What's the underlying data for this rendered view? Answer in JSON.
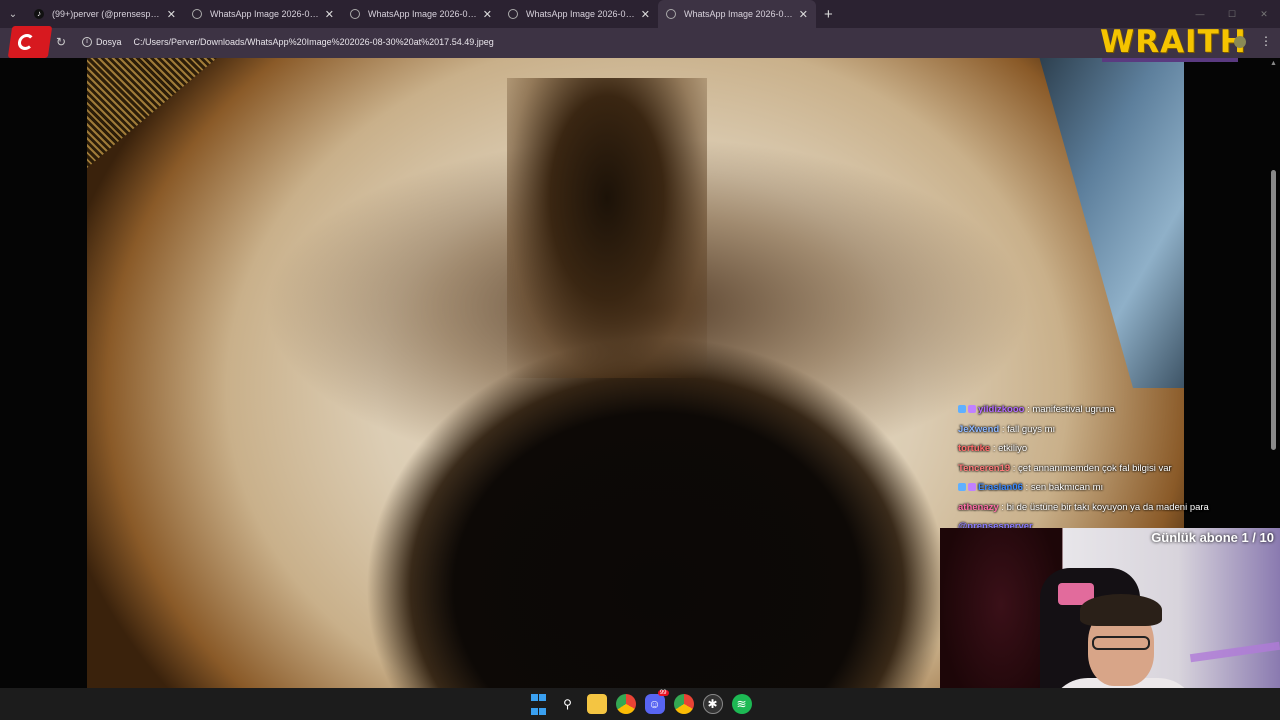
{
  "browser": {
    "tabs": [
      {
        "title": "(99+)perver (@prensesperver) |",
        "favicon": "tiktok-icon",
        "active": false
      },
      {
        "title": "WhatsApp Image 2026-08-30 a",
        "favicon": "globe-icon",
        "active": false
      },
      {
        "title": "WhatsApp Image 2026-08-30 a",
        "favicon": "globe-icon",
        "active": false
      },
      {
        "title": "WhatsApp Image 2026-08-30 a",
        "favicon": "globe-icon",
        "active": false
      },
      {
        "title": "WhatsApp Image 2026-08-30 a",
        "favicon": "globe-icon",
        "active": true
      }
    ],
    "new_tab": "+",
    "address": {
      "chip": "Dosya",
      "url": "C:/Users/Perver/Downloads/WhatsApp%20Image%202026-08-30%20at%2017.54.49.jpeg"
    }
  },
  "overlay": {
    "logo_text": "WRAITH",
    "subgoal": "Günlük abone 1 / 10"
  },
  "chat": [
    {
      "user": "yildizkooo",
      "message": "manifestival ugruna",
      "color": "#b36bff",
      "badges": true
    },
    {
      "user": "JeXwend",
      "message": "fall guys mı",
      "color": "#8fb8ff",
      "badges": false
    },
    {
      "user": "tortuke",
      "message": "etkiliyo",
      "color": "#ff6b6b",
      "badges": false
    },
    {
      "user": "Tenceren19",
      "message": "çet annanımemden çok fal bilgisi var",
      "color": "#ff7b7b",
      "badges": false
    },
    {
      "user": "Eraslan06",
      "message": "sen bakmıcan mı",
      "color": "#3d8bff",
      "badges": true
    },
    {
      "user": "athenazy",
      "message": "bi de üstüne bir takı koyuyon ya da madeni para",
      "color": "#ff6fa8",
      "badges": false
    },
    {
      "user": "@prensesperver",
      "message": "",
      "color": "#8a7aff",
      "badges": false
    }
  ],
  "taskbar": {
    "icons": [
      "windows-start-icon",
      "search-icon",
      "file-explorer-icon",
      "chrome-icon",
      "discord-icon",
      "chrome-alt-icon",
      "rockstar-icon",
      "spotify-icon"
    ],
    "discord_badge": "99"
  }
}
